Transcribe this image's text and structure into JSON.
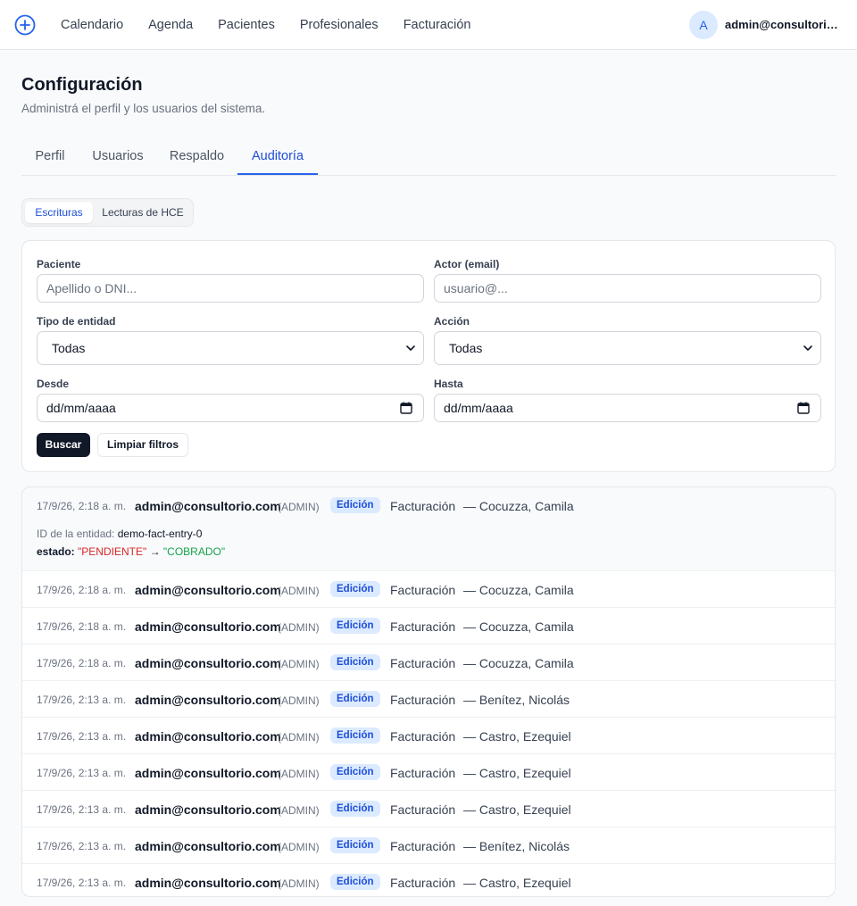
{
  "nav": {
    "items": [
      "Calendario",
      "Agenda",
      "Pacientes",
      "Profesionales",
      "Facturación"
    ],
    "user_initial": "A",
    "user_email": "admin@consultorio.c..."
  },
  "header": {
    "title": "Configuración",
    "subtitle": "Administrá el perfil y los usuarios del sistema."
  },
  "tabs": {
    "items": [
      "Perfil",
      "Usuarios",
      "Respaldo",
      "Auditoría"
    ],
    "active": "Auditoría"
  },
  "subtabs": {
    "items": [
      "Escrituras",
      "Lecturas de HCE"
    ],
    "active": "Escrituras"
  },
  "filters": {
    "patient_label": "Paciente",
    "patient_placeholder": "Apellido o DNI...",
    "actor_label": "Actor (email)",
    "actor_placeholder": "usuario@...",
    "entity_type_label": "Tipo de entidad",
    "entity_type_value": "Todas",
    "action_label": "Acción",
    "action_value": "Todas",
    "from_label": "Desde",
    "from_value": "dd/mm/aaaa",
    "to_label": "Hasta",
    "to_value": "dd/mm/aaaa",
    "search_button": "Buscar",
    "clear_button": "Limpiar filtros"
  },
  "audit": {
    "expanded_detail": {
      "id_label": "ID de la entidad:",
      "id_value": "demo-fact-entry-0",
      "field": "estado:",
      "old_value": "\"PENDIENTE\"",
      "arrow": "→",
      "new_value": "\"COBRADO\""
    },
    "rows": [
      {
        "time": "17/9/26, 2:18 a. m.",
        "actor": "admin@consultorio.com",
        "role": "(ADMIN)",
        "action": "Edición",
        "entity": "Facturación",
        "patient": "— Cocuzza, Camila"
      },
      {
        "time": "17/9/26, 2:18 a. m.",
        "actor": "admin@consultorio.com",
        "role": "(ADMIN)",
        "action": "Edición",
        "entity": "Facturación",
        "patient": "— Cocuzza, Camila"
      },
      {
        "time": "17/9/26, 2:18 a. m.",
        "actor": "admin@consultorio.com",
        "role": "(ADMIN)",
        "action": "Edición",
        "entity": "Facturación",
        "patient": "— Cocuzza, Camila"
      },
      {
        "time": "17/9/26, 2:18 a. m.",
        "actor": "admin@consultorio.com",
        "role": "(ADMIN)",
        "action": "Edición",
        "entity": "Facturación",
        "patient": "— Cocuzza, Camila"
      },
      {
        "time": "17/9/26, 2:13 a. m.",
        "actor": "admin@consultorio.com",
        "role": "(ADMIN)",
        "action": "Edición",
        "entity": "Facturación",
        "patient": "— Benítez, Nicolás"
      },
      {
        "time": "17/9/26, 2:13 a. m.",
        "actor": "admin@consultorio.com",
        "role": "(ADMIN)",
        "action": "Edición",
        "entity": "Facturación",
        "patient": "— Castro, Ezequiel"
      },
      {
        "time": "17/9/26, 2:13 a. m.",
        "actor": "admin@consultorio.com",
        "role": "(ADMIN)",
        "action": "Edición",
        "entity": "Facturación",
        "patient": "— Castro, Ezequiel"
      },
      {
        "time": "17/9/26, 2:13 a. m.",
        "actor": "admin@consultorio.com",
        "role": "(ADMIN)",
        "action": "Edición",
        "entity": "Facturación",
        "patient": "— Castro, Ezequiel"
      },
      {
        "time": "17/9/26, 2:13 a. m.",
        "actor": "admin@consultorio.com",
        "role": "(ADMIN)",
        "action": "Edición",
        "entity": "Facturación",
        "patient": "— Benítez, Nicolás"
      },
      {
        "time": "17/9/26, 2:13 a. m.",
        "actor": "admin@consultorio.com",
        "role": "(ADMIN)",
        "action": "Edición",
        "entity": "Facturación",
        "patient": "— Castro, Ezequiel"
      }
    ]
  },
  "icons": {
    "logo": "plus-circle-icon",
    "select": "chevron-down-icon",
    "date": "calendar-icon"
  },
  "colors": {
    "accent": "#2563eb",
    "badge_bg": "#dbeafe",
    "old_value": "#dc2626",
    "new_value": "#16a34a"
  }
}
